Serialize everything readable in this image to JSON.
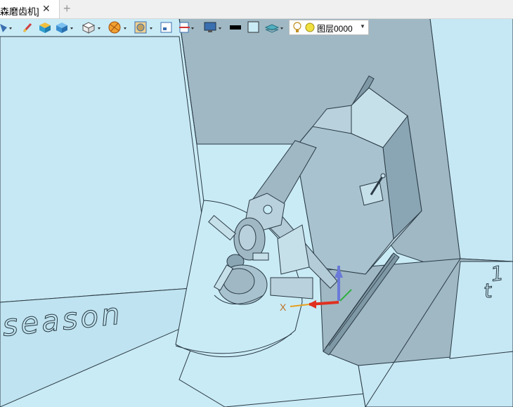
{
  "tab": {
    "title": "森磨齿机]",
    "close_symbol": "✕",
    "add_symbol": "+"
  },
  "toolbar": {
    "layer_name": "图层0000",
    "layer_caret": "▼",
    "items": [
      {
        "name": "view-orient-icon"
      },
      {
        "name": "pen-icon"
      },
      {
        "name": "box-color-icon"
      },
      {
        "name": "cube-icon"
      },
      {
        "name": "wireframe-cube-icon"
      },
      {
        "name": "render-mode-icon"
      },
      {
        "name": "material-icon"
      },
      {
        "name": "view-frame-icon"
      },
      {
        "name": "section-icon"
      },
      {
        "name": "display-icon"
      },
      {
        "name": "line-color-icon"
      },
      {
        "name": "fill-color-icon"
      },
      {
        "name": "layer-manager-icon"
      },
      {
        "name": "layer-light-icon"
      },
      {
        "name": "layer-color-icon"
      }
    ]
  },
  "viewport": {
    "axis_label_x": "X",
    "engraved_text_left": "season",
    "engraved_text_right_top": "1",
    "engraved_text_right_bottom": "t"
  },
  "colors": {
    "background": "#c9ebf6",
    "steel": "#9fb8c4",
    "steel_dark": "#8aa6b4",
    "steel_light": "#b9d1dc",
    "edge": "#2a3a44",
    "axis_x": "#e03020",
    "axis_y": "#30b040",
    "axis_z": "#6a7ad8"
  }
}
